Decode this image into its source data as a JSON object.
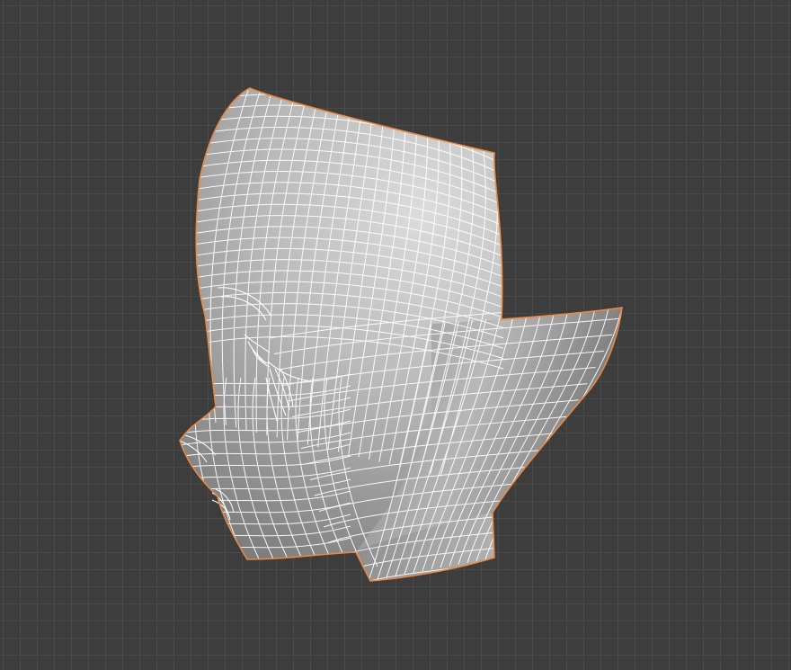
{
  "viewport": {
    "mode": "edit-mode-wireframe-overlay",
    "selection_outline_color": "#e88a45",
    "wire_color": "#ffffff",
    "grid_color": "#4a4a4a",
    "background_color": "#3d3d3d",
    "object": "head-mesh"
  }
}
